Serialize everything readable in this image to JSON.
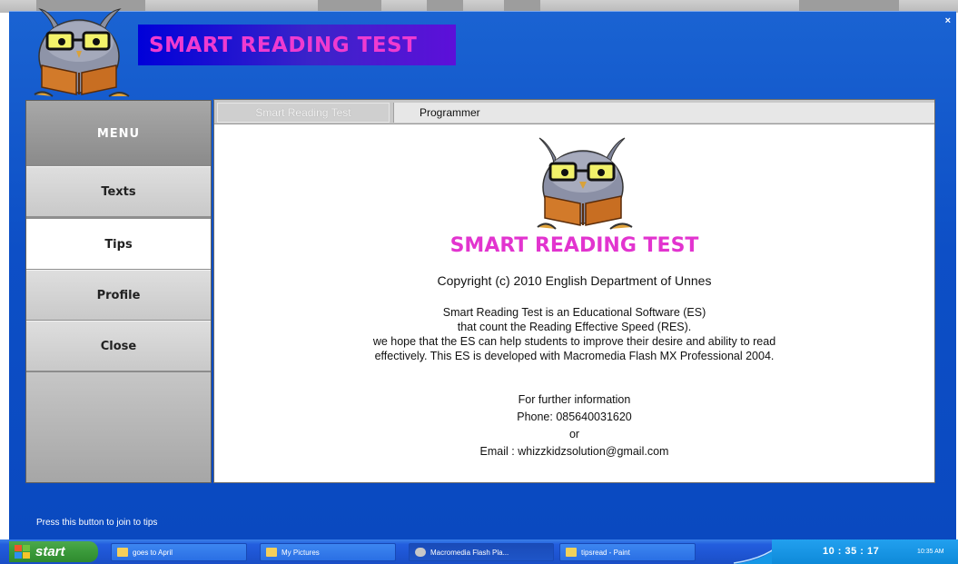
{
  "app": {
    "title": "SMART READING TEST",
    "close_glyph": "×",
    "menu": {
      "header": "MENU",
      "items": [
        {
          "label": "Texts",
          "active": false
        },
        {
          "label": "Tips",
          "active": true
        },
        {
          "label": "Profile",
          "active": false
        },
        {
          "label": "Close",
          "active": false
        }
      ]
    },
    "tabs": [
      {
        "label": "Smart Reading Test",
        "active": true
      },
      {
        "label": "Programmer",
        "active": false
      }
    ],
    "content": {
      "title": "SMART READING TEST",
      "copyright": "Copyright (c) 2010 English Department of Unnes",
      "description": [
        "Smart Reading Test is an  Educational Software  (ES)",
        "that count the Reading Effective Speed (RES).",
        "we hope that the ES can help students to improve their desire and ability to read",
        "effectively. This ES  is developed with  Macromedia Flash MX Professional 2004."
      ],
      "contact": [
        "For further information",
        "Phone: 085640031620",
        "or",
        "Email : whizzkidzsolution@gmail.com"
      ]
    },
    "hint": "Press this button to join to tips"
  },
  "taskbar": {
    "start_label": "start",
    "tasks": [
      {
        "label": "goes to April",
        "icon": "folder-icon"
      },
      {
        "label": "My Pictures",
        "icon": "folder-icon"
      },
      {
        "label": "Macromedia Flash Pla...",
        "icon": "flash-player-icon"
      },
      {
        "label": "tipsread - Paint",
        "icon": "paint-icon"
      }
    ],
    "clock": "10 : 35 : 17",
    "tray_time": "10:35 AM"
  },
  "colors": {
    "app_blue": "#0d4fc6",
    "title_pink": "#e234cf",
    "banner_blue": "#0000d9",
    "taskbar_blue": "#235ede",
    "start_green": "#3a9a3a"
  }
}
